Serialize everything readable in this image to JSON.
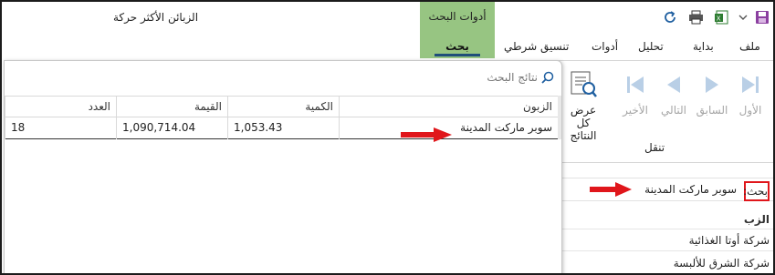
{
  "window": {
    "title": "الزبائن الأكثر حركة",
    "context_group_title": "أدوات البحث"
  },
  "tabs": {
    "file": "ملف",
    "home": "بداية",
    "analysis": "تحليل",
    "tools": "أدوات",
    "conditional_format": "تنسيق شرطي",
    "search": "بحث"
  },
  "ribbon": {
    "first": "الأول",
    "previous": "السابق",
    "next": "التالي",
    "last": "الأخير",
    "show_all": "عرض كل النتائج",
    "group_label": "تنقل"
  },
  "search_panel": {
    "label": "بحث:",
    "value": "سوبر ماركت المدينة",
    "column_header": "الزب",
    "rows": [
      "شركة أوتا الغذائية",
      "شركة الشرق للألبسة"
    ]
  },
  "results_popup": {
    "placeholder": "نتائج البحث",
    "columns": {
      "customer": "الزبون",
      "quantity": "الكمية",
      "value": "القيمة",
      "count": "العدد"
    },
    "rows": [
      {
        "customer": "سوبر ماركت المدينة",
        "quantity": "1,053.43",
        "value": "1,090,714.04",
        "count": "18"
      }
    ]
  },
  "colors": {
    "context_green": "#97c582",
    "annotation_red": "#e0161b",
    "tab_underline": "#1f4e7a"
  },
  "icons": [
    "save-icon",
    "chevron-down-icon",
    "excel-export-icon",
    "print-icon",
    "refresh-icon",
    "first-icon",
    "previous-icon",
    "next-icon",
    "last-icon",
    "show-all-results-icon",
    "search-icon",
    "red-arrow-icon"
  ]
}
